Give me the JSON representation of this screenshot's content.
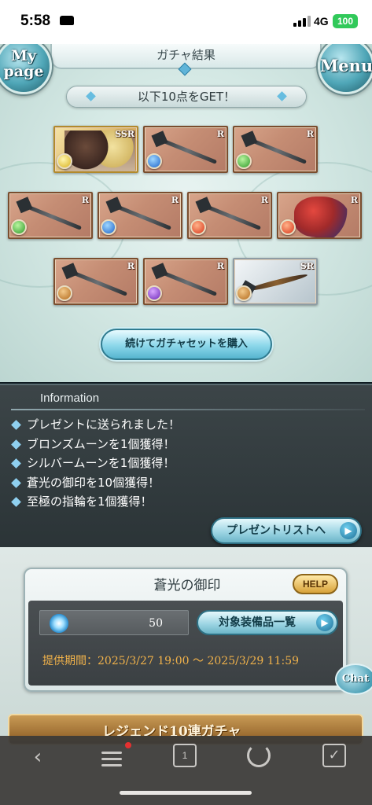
{
  "status_bar": {
    "time": "5:58",
    "network": "4G",
    "battery": "100",
    "icons": [
      "car-icon",
      "signal-icon"
    ]
  },
  "header": {
    "title": "ガチャ結果",
    "mypage_label": "My page",
    "menu_label": "Menu"
  },
  "get_banner": "以下10点をGET！",
  "items": [
    {
      "rarity": "SSR",
      "element": "light",
      "kind": "character"
    },
    {
      "rarity": "R",
      "element": "water",
      "kind": "spear"
    },
    {
      "rarity": "R",
      "element": "wind",
      "kind": "gun"
    },
    {
      "rarity": "R",
      "element": "wind",
      "kind": "spear"
    },
    {
      "rarity": "R",
      "element": "water",
      "kind": "scythe"
    },
    {
      "rarity": "R",
      "element": "fire",
      "kind": "gun"
    },
    {
      "rarity": "R",
      "element": "fire",
      "kind": "summon"
    },
    {
      "rarity": "R",
      "element": "earth",
      "kind": "axe-spear"
    },
    {
      "rarity": "R",
      "element": "dark",
      "kind": "axe"
    },
    {
      "rarity": "SR",
      "element": "earth",
      "kind": "bow"
    }
  ],
  "continue_button": "続けてガチャセットを購入",
  "information": {
    "title": "Information",
    "lines": [
      "プレゼントに送られました！",
      "ブロンズムーンを1個獲得！",
      "シルバームーンを1個獲得！",
      "蒼光の御印を10個獲得！",
      "至極の指輪を1個獲得！"
    ],
    "present_list_button": "プレゼントリストへ"
  },
  "seal": {
    "title": "蒼光の御印",
    "help_label": "HELP",
    "count": "50",
    "equipment_button": "対象装備品一覧",
    "period": "提供期間：2025/3/27 19:00 〜 2025/3/29 11:59"
  },
  "chat_label": "Chat",
  "legend_banner": "レジェンド10連ガチャ",
  "browser_toolbar": {
    "tab_count": "1",
    "icons": [
      "back-icon",
      "menu-icon",
      "tabs-icon",
      "reload-icon",
      "checkbox-icon"
    ]
  },
  "colors": {
    "accent_blue": "#5fb4d8",
    "period_orange": "#f0b24a",
    "battery_green": "#31c95a"
  }
}
